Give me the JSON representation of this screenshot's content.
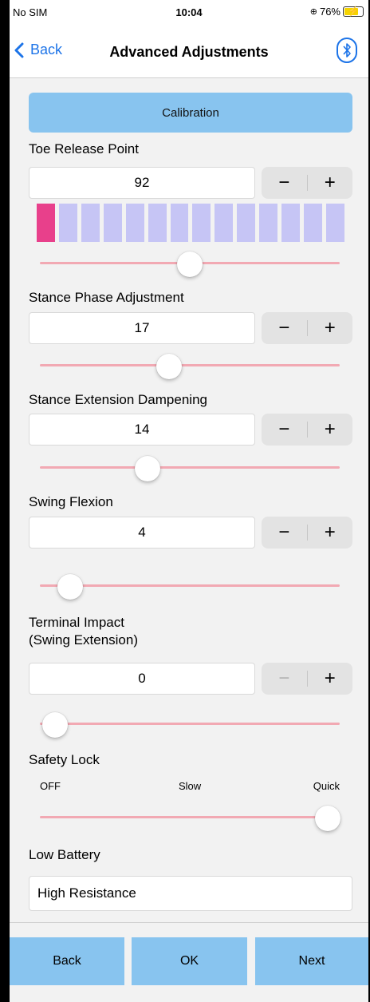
{
  "status": {
    "carrier": "No SIM",
    "time": "10:04",
    "battery_text": "76%",
    "battery_level": 0.76
  },
  "nav": {
    "back_label": "Back",
    "title": "Advanced Adjustments",
    "bluetooth_icon": "bluetooth-icon"
  },
  "calibration_label": "Calibration",
  "toe_release": {
    "label": "Toe Release Point",
    "value": "92",
    "active_segment": 1,
    "segments": 14,
    "slider_fraction": 0.5
  },
  "stance_phase": {
    "label": "Stance Phase Adjustment",
    "value": "17",
    "slider_fraction": 0.43
  },
  "stance_extension": {
    "label": "Stance Extension Dampening",
    "value": "14",
    "slider_fraction": 0.36
  },
  "swing_flexion": {
    "label": "Swing Flexion",
    "value": "4",
    "slider_fraction": 0.1
  },
  "terminal_impact": {
    "label_line1": "Terminal Impact",
    "label_line2": "(Swing Extension)",
    "value": "0",
    "slider_fraction": 0.05
  },
  "stepper": {
    "minus": "−",
    "plus": "+"
  },
  "safety_lock": {
    "label": "Safety Lock",
    "options": [
      "OFF",
      "Slow",
      "Quick"
    ],
    "slider_fraction": 0.96
  },
  "low_battery": {
    "label": "Low Battery",
    "value": "High Resistance"
  },
  "bottom": {
    "back": "Back",
    "ok": "OK",
    "next": "Next"
  },
  "colors": {
    "accent": "#88c4ef",
    "active_segment": "#e8408b",
    "segment": "#c6c5f5",
    "slider_track": "#f2a9b3",
    "link": "#1d74e8"
  }
}
